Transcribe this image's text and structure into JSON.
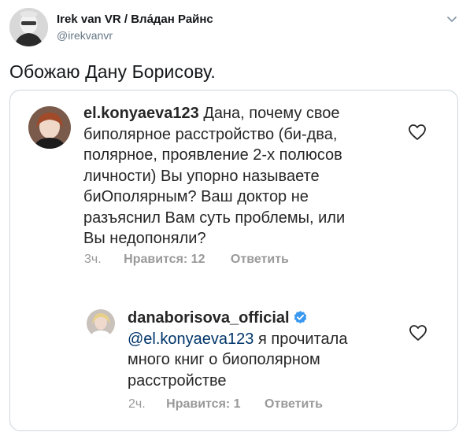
{
  "tweet": {
    "author_name": "Irek van VR / Вла́дан Райнс",
    "author_handle": "@irekvanvr",
    "text": "Обожаю Дану Борисову."
  },
  "comments": [
    {
      "username": "el.konyaeva123",
      "text": "Дана, почему свое\nбиполярное расстройство (би-два,\nполярное, проявление 2-х полюсов\nличности) Вы упорно называете\nбиОполярным? Ваш доктор не\nразъяснил Вам суть проблемы, или\nВы недопоняли?",
      "time": "3ч.",
      "likes": "Нравится: 12",
      "reply": "Ответить"
    },
    {
      "username": "danaborisova_official",
      "mention": "@el.konyaeva123",
      "text": " я прочитала\nмного книг о биополярном\nрасстройстве",
      "time": "2ч.",
      "likes": "Нравится: 1",
      "reply": "Ответить"
    }
  ],
  "colors": {
    "text": "#262626",
    "meta": "#999999",
    "mention": "#003569",
    "verified": "#3897f0",
    "card_border": "#ccd6dd",
    "handle": "#657786"
  },
  "icons": [
    "caret-down-icon",
    "heart-icon",
    "verified-badge-icon"
  ]
}
